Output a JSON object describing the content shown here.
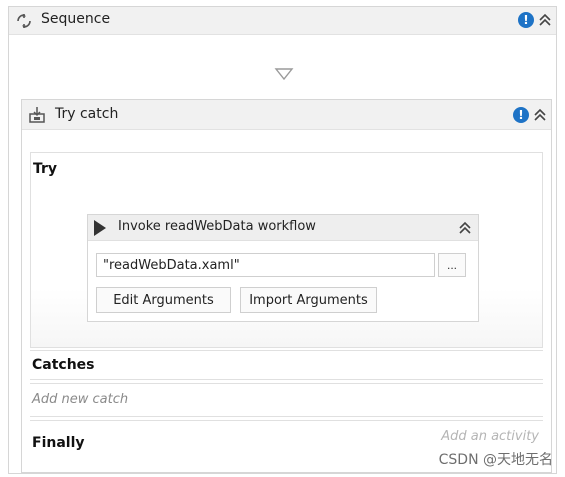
{
  "sequence": {
    "title": "Sequence"
  },
  "try_catch": {
    "title": "Try catch",
    "try_label": "Try",
    "catches_label": "Catches",
    "add_catch_label": "Add new catch",
    "finally_label": "Finally",
    "add_activity_hint": "Add an activity"
  },
  "invoke": {
    "title": "Invoke readWebData workflow",
    "file_value": "\"readWebData.xaml\"",
    "browse_label": "...",
    "edit_arguments_label": "Edit Arguments",
    "import_arguments_label": "Import Arguments"
  },
  "watermark": {
    "text": "CSDN @天地无名"
  },
  "icons": {
    "sequence": "sequence-icon",
    "try_catch": "try-catch-icon",
    "invoke": "play-icon",
    "info": "info-icon",
    "collapse": "double-chevron-up-icon",
    "drop": "drop-arrow-icon"
  },
  "colors": {
    "info_blue": "#1e73c6",
    "header_bg": "#f1f1f1"
  }
}
